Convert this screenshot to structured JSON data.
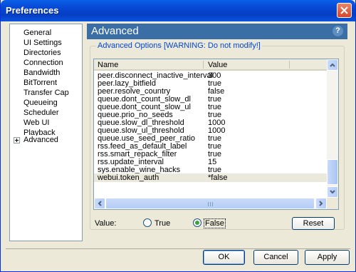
{
  "window": {
    "title": "Preferences"
  },
  "sidebar": {
    "items": [
      {
        "label": "General"
      },
      {
        "label": "UI Settings"
      },
      {
        "label": "Directories"
      },
      {
        "label": "Connection"
      },
      {
        "label": "Bandwidth"
      },
      {
        "label": "BitTorrent"
      },
      {
        "label": "Transfer Cap"
      },
      {
        "label": "Queueing"
      },
      {
        "label": "Scheduler"
      },
      {
        "label": "Web UI"
      },
      {
        "label": "Playback"
      },
      {
        "label": "Advanced"
      }
    ],
    "selected_index": 11
  },
  "panel": {
    "title": "Advanced",
    "help_glyph": "?",
    "group_title": "Advanced Options [WARNING: Do not modify!]"
  },
  "table": {
    "columns": [
      "Name",
      "Value"
    ],
    "rows": [
      {
        "name": "peer.disconnect_inactive_interval",
        "value": "300"
      },
      {
        "name": "peer.lazy_bitfield",
        "value": "true"
      },
      {
        "name": "peer.resolve_country",
        "value": "false"
      },
      {
        "name": "queue.dont_count_slow_dl",
        "value": "true"
      },
      {
        "name": "queue.dont_count_slow_ul",
        "value": "true"
      },
      {
        "name": "queue.prio_no_seeds",
        "value": "true"
      },
      {
        "name": "queue.slow_dl_threshold",
        "value": "1000"
      },
      {
        "name": "queue.slow_ul_threshold",
        "value": "1000"
      },
      {
        "name": "queue.use_seed_peer_ratio",
        "value": "true"
      },
      {
        "name": "rss.feed_as_default_label",
        "value": "true"
      },
      {
        "name": "rss.smart_repack_filter",
        "value": "true"
      },
      {
        "name": "rss.update_interval",
        "value": "15"
      },
      {
        "name": "sys.enable_wine_hacks",
        "value": "true"
      },
      {
        "name": "webui.token_auth",
        "value": "*false"
      }
    ],
    "selected_index": 13
  },
  "value_editor": {
    "label": "Value:",
    "true_label": "True",
    "false_label": "False",
    "selected": "False",
    "reset_label": "Reset"
  },
  "buttons": {
    "ok": "OK",
    "cancel": "Cancel",
    "apply": "Apply"
  },
  "colors": {
    "titlebar": "#0a5fe8",
    "header_bg": "#3a6ea5",
    "group_title": "#0046d5",
    "selected_row": "#ebe9dc"
  }
}
